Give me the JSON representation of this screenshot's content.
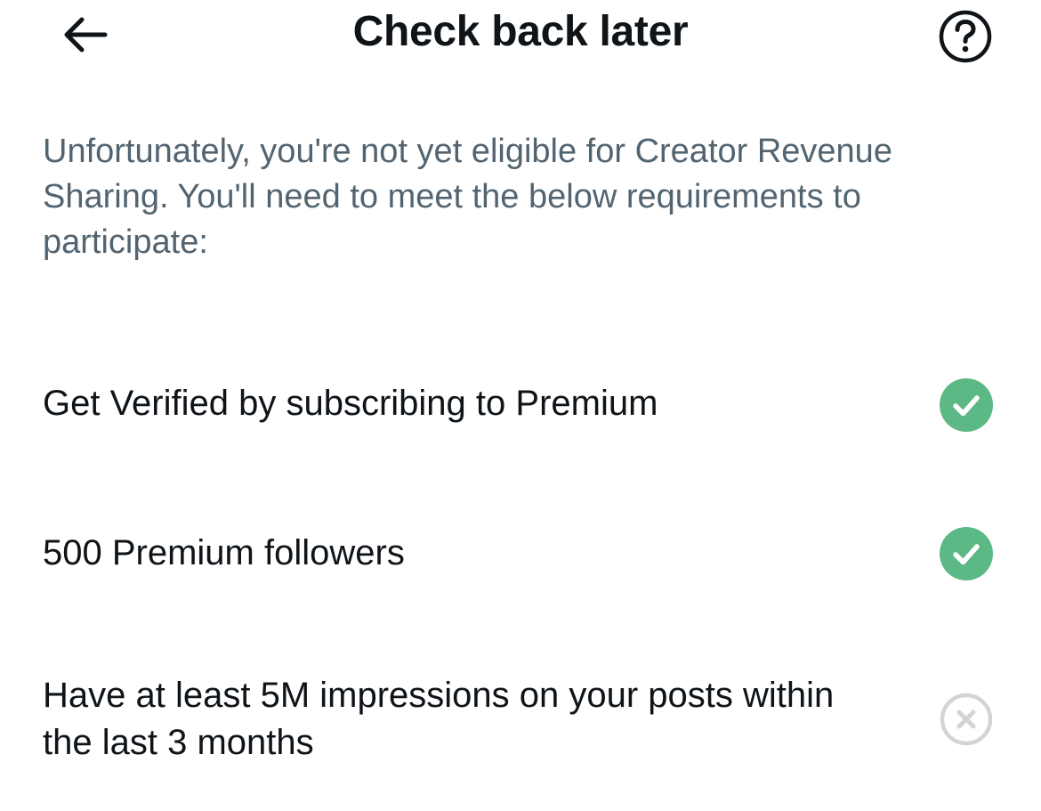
{
  "header": {
    "title": "Check back later",
    "back_icon": "arrow-left-icon",
    "help_icon": "question-circle-icon"
  },
  "intro": "Unfortunately, you're not yet eligible for Creator Revenue Sharing. You'll need to meet the below requirements to participate:",
  "requirements": [
    {
      "label": "Get Verified by subscribing to Premium",
      "status": "met",
      "icon": "check-circle-icon"
    },
    {
      "label": "500 Premium followers",
      "status": "met",
      "icon": "check-circle-icon"
    },
    {
      "label": "Have at least 5M impressions on your posts within the last 3 months",
      "status": "not-met",
      "icon": "x-circle-icon"
    }
  ],
  "colors": {
    "text_primary": "#0f1419",
    "text_secondary": "#536471",
    "success_green": "#5cb885",
    "muted_gray": "#d4d4d4"
  }
}
